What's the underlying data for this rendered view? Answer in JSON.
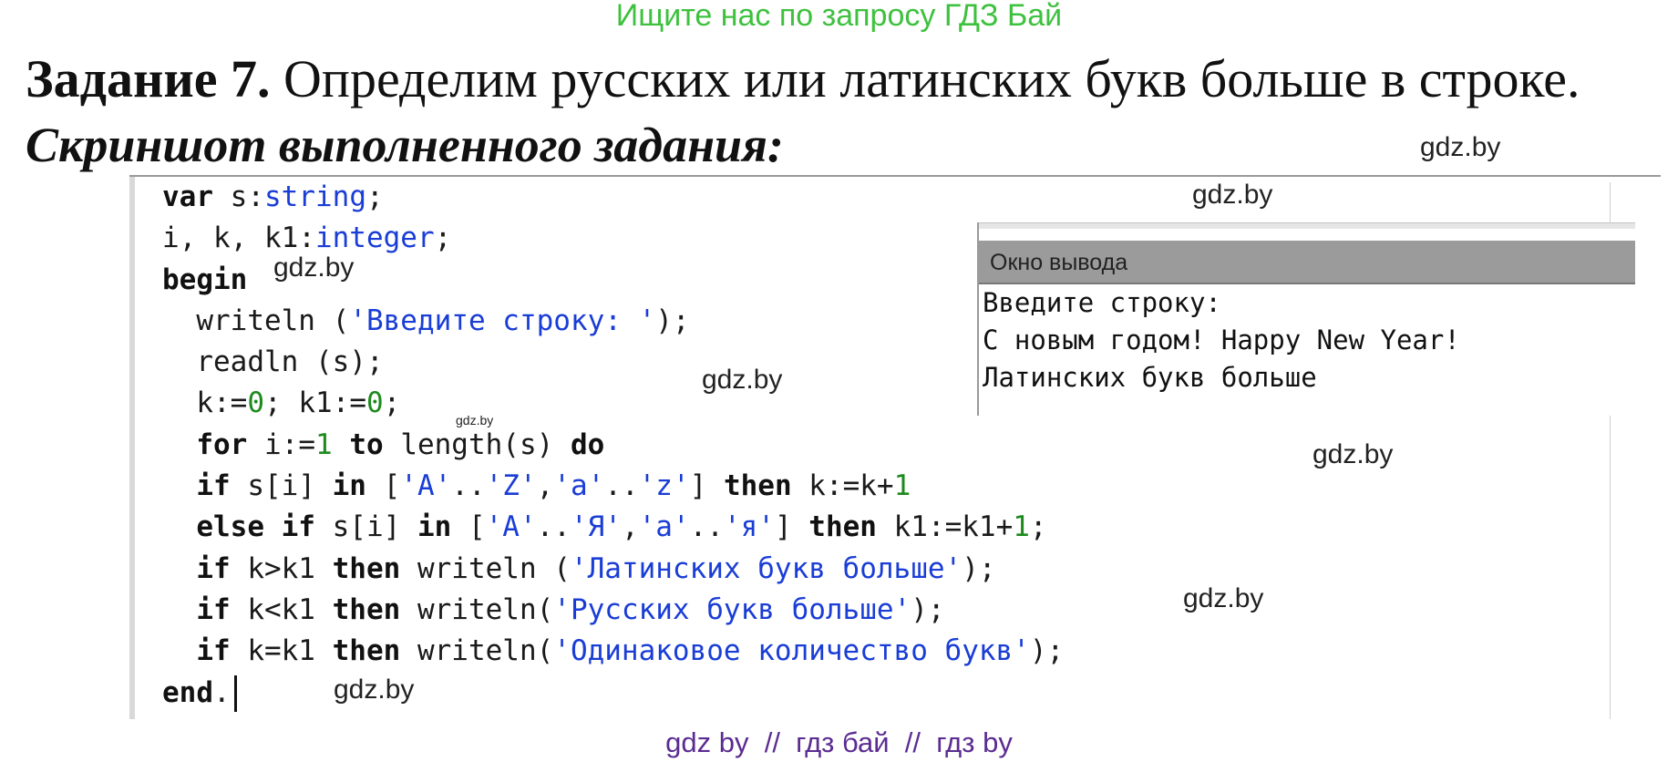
{
  "banner": "Ищите нас по запросу ГДЗ Бай",
  "task": {
    "label": "Задание 7.",
    "text": " Определим русских или латинских букв больше в строке."
  },
  "caption": "Скриншот выполненного задания:",
  "watermarks": {
    "w1": "gdz.by",
    "w2": "gdz.by",
    "w3": "gdz.by",
    "w4": "gdz.by",
    "w5": "gdz.by",
    "w6": "gdz.by",
    "w7": "gdz.by",
    "w8": "gdz.by"
  },
  "code": {
    "lines": [
      [
        {
          "t": "var",
          "c": "kw"
        },
        {
          "t": " s:",
          "c": ""
        },
        {
          "t": "string",
          "c": "ty"
        },
        {
          "t": ";",
          "c": ""
        }
      ],
      [
        {
          "t": "i, k, k1:",
          "c": ""
        },
        {
          "t": "integer",
          "c": "ty"
        },
        {
          "t": ";",
          "c": ""
        }
      ],
      [
        {
          "t": "begin",
          "c": "kw"
        }
      ],
      [
        {
          "t": "  writeln (",
          "c": ""
        },
        {
          "t": "'Введите строку: '",
          "c": "st"
        },
        {
          "t": ");",
          "c": ""
        }
      ],
      [
        {
          "t": "  readln (s);",
          "c": ""
        }
      ],
      [
        {
          "t": "  k:=",
          "c": ""
        },
        {
          "t": "0",
          "c": "nm"
        },
        {
          "t": "; k1:=",
          "c": ""
        },
        {
          "t": "0",
          "c": "nm"
        },
        {
          "t": ";",
          "c": ""
        }
      ],
      [
        {
          "t": "  ",
          "c": ""
        },
        {
          "t": "for",
          "c": "kw"
        },
        {
          "t": " i:=",
          "c": ""
        },
        {
          "t": "1",
          "c": "nm"
        },
        {
          "t": " ",
          "c": ""
        },
        {
          "t": "to",
          "c": "kw"
        },
        {
          "t": " length(s) ",
          "c": ""
        },
        {
          "t": "do",
          "c": "kw"
        }
      ],
      [
        {
          "t": "  ",
          "c": ""
        },
        {
          "t": "if",
          "c": "kw"
        },
        {
          "t": " s[i] ",
          "c": ""
        },
        {
          "t": "in",
          "c": "kw"
        },
        {
          "t": " [",
          "c": ""
        },
        {
          "t": "'A'",
          "c": "st"
        },
        {
          "t": "..",
          "c": ""
        },
        {
          "t": "'Z'",
          "c": "st"
        },
        {
          "t": ",",
          "c": ""
        },
        {
          "t": "'a'",
          "c": "st"
        },
        {
          "t": "..",
          "c": ""
        },
        {
          "t": "'z'",
          "c": "st"
        },
        {
          "t": "] ",
          "c": ""
        },
        {
          "t": "then",
          "c": "kw"
        },
        {
          "t": " k:=k+",
          "c": ""
        },
        {
          "t": "1",
          "c": "nm"
        }
      ],
      [
        {
          "t": "  ",
          "c": ""
        },
        {
          "t": "else if",
          "c": "kw"
        },
        {
          "t": " s[i] ",
          "c": ""
        },
        {
          "t": "in",
          "c": "kw"
        },
        {
          "t": " [",
          "c": ""
        },
        {
          "t": "'А'",
          "c": "st"
        },
        {
          "t": "..",
          "c": ""
        },
        {
          "t": "'Я'",
          "c": "st"
        },
        {
          "t": ",",
          "c": ""
        },
        {
          "t": "'а'",
          "c": "st"
        },
        {
          "t": "..",
          "c": ""
        },
        {
          "t": "'я'",
          "c": "st"
        },
        {
          "t": "] ",
          "c": ""
        },
        {
          "t": "then",
          "c": "kw"
        },
        {
          "t": " k1:=k1+",
          "c": ""
        },
        {
          "t": "1",
          "c": "nm"
        },
        {
          "t": ";",
          "c": ""
        }
      ],
      [
        {
          "t": "  ",
          "c": ""
        },
        {
          "t": "if",
          "c": "kw"
        },
        {
          "t": " k>k1 ",
          "c": ""
        },
        {
          "t": "then",
          "c": "kw"
        },
        {
          "t": " writeln (",
          "c": ""
        },
        {
          "t": "'Латинских букв больше'",
          "c": "st"
        },
        {
          "t": ");",
          "c": ""
        }
      ],
      [
        {
          "t": "  ",
          "c": ""
        },
        {
          "t": "if",
          "c": "kw"
        },
        {
          "t": " k<k1 ",
          "c": ""
        },
        {
          "t": "then",
          "c": "kw"
        },
        {
          "t": " writeln(",
          "c": ""
        },
        {
          "t": "'Русских букв больше'",
          "c": "st"
        },
        {
          "t": ");",
          "c": ""
        }
      ],
      [
        {
          "t": "  ",
          "c": ""
        },
        {
          "t": "if",
          "c": "kw"
        },
        {
          "t": " k=k1 ",
          "c": ""
        },
        {
          "t": "then",
          "c": "kw"
        },
        {
          "t": " writeln(",
          "c": ""
        },
        {
          "t": "'Одинаковое количество букв'",
          "c": "st"
        },
        {
          "t": ");",
          "c": ""
        }
      ],
      [
        {
          "t": "end",
          "c": "kw"
        },
        {
          "t": ".",
          "c": ""
        }
      ]
    ]
  },
  "output_window": {
    "title": "Окно вывода",
    "lines": [
      "Введите строку:",
      "С новым годом! Happy New Year!",
      "Латинских букв больше"
    ]
  },
  "footer": "gdz by  //  гдз бай  //  гдз by",
  "colors": {
    "banner": "#3ec13e",
    "keyword": "#111111",
    "type_and_string": "#1a3dd6",
    "number": "#1d8a1d",
    "footer": "#5b2c91",
    "output_header": "#9b9b9b"
  }
}
